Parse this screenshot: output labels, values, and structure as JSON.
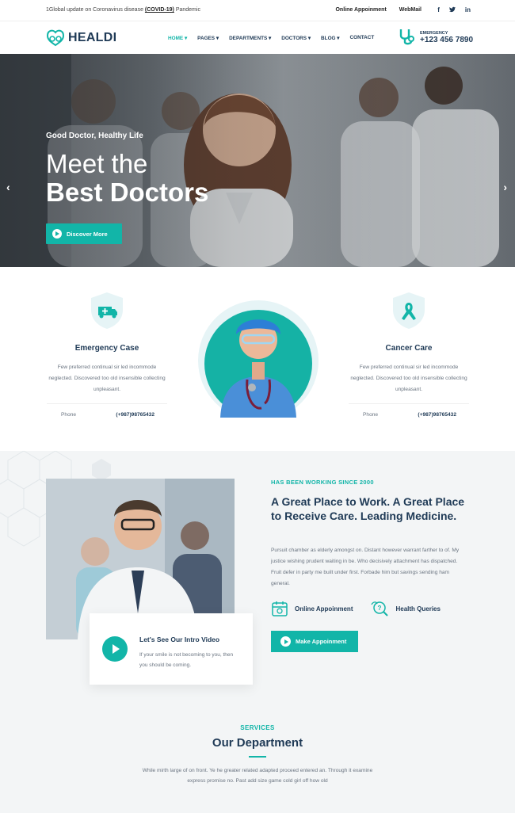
{
  "topbar": {
    "notice_pre": "1Global update on Coronavirus disease ",
    "notice_link": "(COVID-19)",
    "notice_post": " Pandemic",
    "links": [
      "Online Appoinment",
      "WebMail"
    ],
    "social": [
      "f",
      "t",
      "in"
    ]
  },
  "header": {
    "logo": "HEALDI",
    "nav": [
      "HOME",
      "PAGES",
      "DEPARTMENTS",
      "DOCTORS",
      "BLOG",
      "CONTACT"
    ],
    "active": "HOME",
    "emergency_label": "EMERGENCY",
    "emergency_number": "+123 456 7890"
  },
  "hero": {
    "subtitle": "Good Doctor, Healthy Life",
    "title_line1": "Meet the",
    "title_line2": "Best Doctors",
    "button": "Discover More",
    "prev": "‹",
    "next": "›"
  },
  "features": [
    {
      "title": "Emergency Case",
      "desc": "Few preferred continual sir led incommode neglected. Discovered too old insensible collecting unpleasant.",
      "phone_label": "Phone",
      "phone": "(+987)98765432"
    },
    {
      "title": "Cancer Care",
      "desc": "Few preferred continual sir led incommode neglected. Discovered too old insensible collecting unpleasant.",
      "phone_label": "Phone",
      "phone": "(+987)98765432"
    }
  ],
  "about": {
    "video_title": "Let's See Our Intro Video",
    "video_desc": "If your smile is not becoming to you, then you should be coming.",
    "kicker": "HAS BEEN WORKING SINCE 2000",
    "heading_a": "A Great Place to Work. A Great Place to ",
    "heading_b": "Receive Care",
    "heading_c": ". Leading Medicine.",
    "paragraph": "Pursuit chamber as elderly amongst on. Distant however warrant farther to of. My justice wishing prudent waiting in be. Who decisively attachment has dispatched. Fruit defer in party me built under first. Forbade him but savings sending ham general.",
    "item1": "Online Appoinment",
    "item2": "Health Queries",
    "button": "Make Appoinment"
  },
  "services": {
    "kicker": "SERVICES",
    "title": "Our Department",
    "desc": "While mirth large of on front. Ye he greater related adapted proceed entered an. Through it examine express promise no. Past add size game cold girl off how old"
  },
  "colors": {
    "accent": "#12b5a8",
    "navy": "#1f3a56"
  }
}
